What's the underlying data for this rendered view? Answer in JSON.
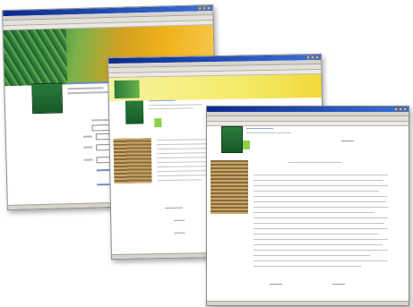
{
  "windows": [
    {
      "id": "window-1",
      "hero_text": "",
      "colors": {
        "hero_left": "#2c7a3a",
        "hero_right": "#f0b21c",
        "link": "#6a8fc8"
      }
    },
    {
      "id": "window-2",
      "colors": {
        "banner": "#f4ec6a",
        "accent": "#8fd04a"
      }
    },
    {
      "id": "window-3",
      "colors": {
        "accent": "#8fd04a"
      }
    }
  ]
}
